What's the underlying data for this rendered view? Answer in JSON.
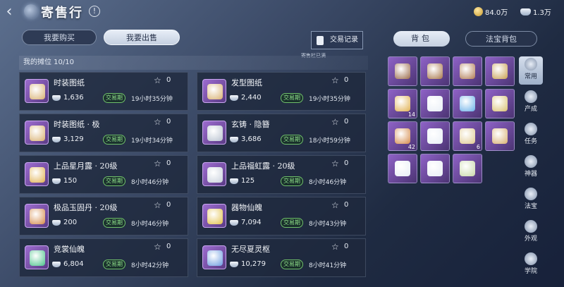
{
  "header": {
    "back_glyph": "‹",
    "title": "寄售行",
    "info_glyph": "!",
    "gold": "84.0万",
    "silver": "1.3万",
    "icons": {
      "back": "back-arrow-icon",
      "info": "info-icon",
      "gold": "gold-coin-icon",
      "silver": "silver-ingot-icon"
    }
  },
  "tabs": {
    "buy": "我要购买",
    "sell": "我要出售"
  },
  "history": {
    "label": "交易记录",
    "sub": "寄售栏已满"
  },
  "stall": {
    "label": "我的摊位  10/10"
  },
  "listings": [
    {
      "name": "时装图纸",
      "price": "1,636",
      "fav": "0",
      "tag": "交易期",
      "time": "19小时35分钟",
      "color": "#d8b070"
    },
    {
      "name": "发型图纸",
      "price": "2,440",
      "fav": "0",
      "tag": "交易期",
      "time": "19小时35分钟",
      "color": "#d8b070"
    },
    {
      "name": "时装图纸 · 极",
      "price": "3,129",
      "fav": "0",
      "tag": "交易期",
      "time": "19小时34分钟",
      "color": "#d8b070"
    },
    {
      "name": "玄铸 · 隐簪",
      "price": "3,686",
      "fav": "0",
      "tag": "交易期",
      "time": "18小时59分钟",
      "color": "#b8c2d0"
    },
    {
      "name": "上品星月露 · 20级",
      "price": "150",
      "fav": "0",
      "tag": "交易期",
      "time": "8小时46分钟",
      "color": "#e0b050"
    },
    {
      "name": "上品福虹露 · 20级",
      "price": "125",
      "fav": "0",
      "tag": "交易期",
      "time": "8小时46分钟",
      "color": "#c8d0dc"
    },
    {
      "name": "极品玉固丹 · 20级",
      "price": "200",
      "fav": "0",
      "tag": "交易期",
      "time": "8小时46分钟",
      "color": "#d48a4a"
    },
    {
      "name": "器物仙魄",
      "price": "7,094",
      "fav": "0",
      "tag": "交易期",
      "time": "8小时43分钟",
      "color": "#e2c04a"
    },
    {
      "name": "竞裳仙魄",
      "price": "6,804",
      "fav": "0",
      "tag": "交易期",
      "time": "8小时42分钟",
      "color": "#4ac28a"
    },
    {
      "name": "无尽夏灵枢",
      "price": "10,279",
      "fav": "0",
      "tag": "交易期",
      "time": "8小时41分钟",
      "color": "#6a9ae0"
    }
  ],
  "bag": {
    "main_tab": "背包",
    "treasure_tab": "法宝背包",
    "slots": [
      {
        "color": "#9a6a4a",
        "count": ""
      },
      {
        "color": "#a8764a",
        "count": ""
      },
      {
        "color": "#b07a52",
        "count": ""
      },
      {
        "color": "#c8a050",
        "count": ""
      },
      {
        "color": "#e0b050",
        "count": "14"
      },
      {
        "color": "#e8eef6",
        "count": ""
      },
      {
        "color": "#6ab0e8",
        "count": ""
      },
      {
        "color": "#d8c070",
        "count": ""
      },
      {
        "color": "#d48a4a",
        "count": "42"
      },
      {
        "color": "#e8eef6",
        "count": ""
      },
      {
        "color": "#e0c890",
        "count": "6"
      },
      {
        "color": "#d8b070",
        "count": ""
      },
      {
        "color": "#e8eef6",
        "count": ""
      },
      {
        "color": "#e8eef6",
        "count": ""
      },
      {
        "color": "#c8d8a8",
        "count": ""
      }
    ],
    "side_tabs": [
      "常用",
      "产成",
      "任务",
      "神器",
      "法宝",
      "外观",
      "学院"
    ]
  }
}
